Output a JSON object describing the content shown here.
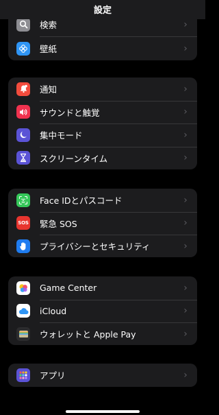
{
  "header": {
    "title": "設定"
  },
  "groups": {
    "top": [
      {
        "label": "検索",
        "icon": "magnifier-icon",
        "color": "#8e8e93"
      },
      {
        "label": "壁紙",
        "icon": "flower-icon",
        "color": "#2f95f5"
      }
    ],
    "notify": [
      {
        "label": "通知",
        "icon": "bell-icon",
        "color": "#f24c3d"
      },
      {
        "label": "サウンドと触覚",
        "icon": "speaker-icon",
        "color": "#f0324f"
      },
      {
        "label": "集中モード",
        "icon": "moon-icon",
        "color": "#5b53d6"
      },
      {
        "label": "スクリーンタイム",
        "icon": "hourglass-icon",
        "color": "#5b53d6"
      }
    ],
    "privacy": [
      {
        "label": "Face IDとパスコード",
        "icon": "faceid-icon",
        "color": "#35c759"
      },
      {
        "label": "緊急 SOS",
        "icon": "sos-icon",
        "color": "#e8352f",
        "badge": "SOS"
      },
      {
        "label": "プライバシーとセキュリティ",
        "icon": "hand-icon",
        "color": "#1f7cf0"
      }
    ],
    "services": [
      {
        "label": "Game Center",
        "icon": "game-center-icon",
        "color": "#ffffff"
      },
      {
        "label": "iCloud",
        "icon": "cloud-icon",
        "color": "#ffffff"
      },
      {
        "label": "ウォレットと Apple Pay",
        "icon": "wallet-icon",
        "color": "#2c2c2e"
      }
    ],
    "apps": [
      {
        "label": "アプリ",
        "icon": "apps-grid-icon",
        "color": "#5b53d6"
      }
    ]
  },
  "chevron": "›"
}
